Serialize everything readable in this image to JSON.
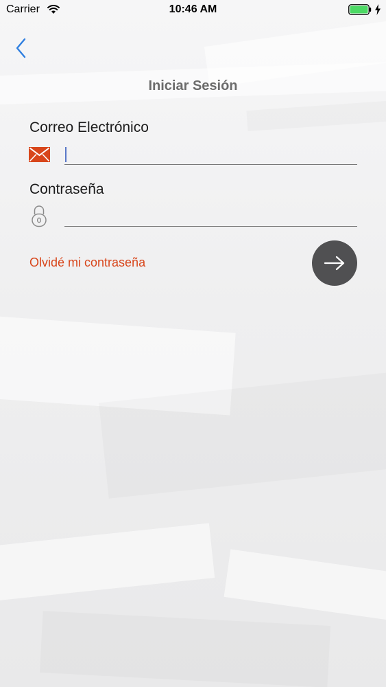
{
  "status_bar": {
    "carrier": "Carrier",
    "time": "10:46 AM"
  },
  "header": {
    "title": "Iniciar Sesión",
    "back_icon": "chevron-left-icon"
  },
  "form": {
    "email": {
      "label": "Correo Electrónico",
      "value": "",
      "placeholder": "",
      "icon": "envelope-icon"
    },
    "password": {
      "label": "Contraseña",
      "value": "",
      "placeholder": "",
      "icon": "padlock-icon"
    },
    "forgot_link": "Olvidé mi contraseña",
    "submit_icon": "arrow-right-icon"
  },
  "colors": {
    "accent_orange": "#d8461b",
    "back_blue": "#2f7fe0",
    "button_dark": "#505052",
    "title_gray": "#6b6b6b"
  }
}
